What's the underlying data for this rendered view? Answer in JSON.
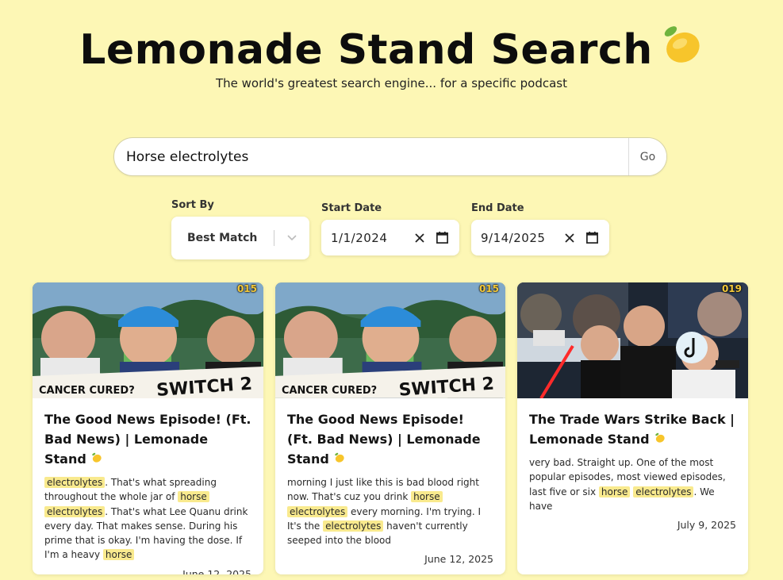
{
  "header": {
    "title": "Lemonade Stand Search",
    "subtitle": "The world's greatest search engine... for a specific podcast"
  },
  "search": {
    "value": "Horse electrolytes",
    "go_label": "Go"
  },
  "filters": {
    "sort_label": "Sort By",
    "sort_value": "Best Match",
    "start_label": "Start Date",
    "start_value": "1/1/2024",
    "end_label": "End Date",
    "end_value": "9/14/2025"
  },
  "colors": {
    "background": "#fdf7b5",
    "highlight": "#f9ea8e",
    "episode_badge": "#f3c93a"
  },
  "results": [
    {
      "episode": "015",
      "title": "The Good News Episode! (Ft. Bad News) | Lemonade Stand",
      "thumb_text_left": "CANCER CURED?",
      "thumb_text_right": "SWITCH 2",
      "snippet": [
        {
          "t": "electrolytes",
          "hl": true
        },
        {
          "t": ". That's what spreading throughout the whole jar of ",
          "hl": false
        },
        {
          "t": "horse",
          "hl": true
        },
        {
          "t": " ",
          "hl": false
        },
        {
          "t": "electrolytes",
          "hl": true
        },
        {
          "t": ". That's what Lee Quanu drink every day. That makes sense. During his prime that is okay. I'm having the dose. If I'm a heavy ",
          "hl": false
        },
        {
          "t": "horse",
          "hl": true
        }
      ],
      "date": "June 12, 2025"
    },
    {
      "episode": "015",
      "title": "The Good News Episode! (Ft. Bad News) | Lemonade Stand",
      "thumb_text_left": "CANCER CURED?",
      "thumb_text_right": "SWITCH 2",
      "snippet": [
        {
          "t": "morning I just like this is bad blood right now. That's cuz you drink ",
          "hl": false
        },
        {
          "t": "horse",
          "hl": true
        },
        {
          "t": " ",
          "hl": false
        },
        {
          "t": "electrolytes",
          "hl": true
        },
        {
          "t": " every morning. I'm trying. I It's the ",
          "hl": false
        },
        {
          "t": "electrolytes",
          "hl": true
        },
        {
          "t": " haven't currently seeped into the blood",
          "hl": false
        }
      ],
      "date": "June 12, 2025"
    },
    {
      "episode": "019",
      "title": "The Trade Wars Strike Back | Lemonade Stand",
      "thumb_text_left": "",
      "thumb_text_right": "",
      "snippet": [
        {
          "t": "very bad. Straight up. One of the most popular episodes, most viewed episodes, last five or six ",
          "hl": false
        },
        {
          "t": "horse",
          "hl": true
        },
        {
          "t": " ",
          "hl": false
        },
        {
          "t": "electrolytes",
          "hl": true
        },
        {
          "t": ". We have",
          "hl": false
        }
      ],
      "date": "July 9, 2025"
    }
  ]
}
